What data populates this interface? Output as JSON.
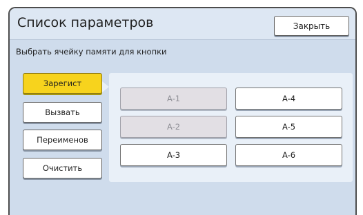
{
  "header": {
    "title": "Список параметров",
    "close_label": "Закрыть"
  },
  "subtitle": "Выбрать ячейку памяти для кнопки",
  "side_buttons": {
    "register": "Зарегист",
    "recall": "Вызвать",
    "rename": "Переименов",
    "clear": "Очистить"
  },
  "memory_slots": [
    {
      "label": "A-1",
      "enabled": false
    },
    {
      "label": "A-2",
      "enabled": false
    },
    {
      "label": "A-3",
      "enabled": true
    },
    {
      "label": "A-4",
      "enabled": true
    },
    {
      "label": "A-5",
      "enabled": true
    },
    {
      "label": "A-6",
      "enabled": true
    }
  ],
  "colors": {
    "accent": "#f7d31d",
    "background": "#cfdcec"
  }
}
